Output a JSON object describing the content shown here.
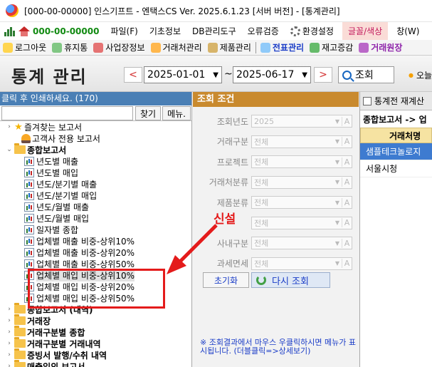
{
  "window": {
    "title": "[000-00-00000] 인스기프트 - 엔택스CS Ver. 2025.6.1.23 [서버 버전] - [통계관리]"
  },
  "menu": {
    "company_code": "000-00-00000",
    "items": [
      "파일(F)",
      "기초정보",
      "DB관리도구",
      "오류검증",
      "환경설정",
      "글꼴/색상",
      "창(W)"
    ]
  },
  "toolbar": {
    "items": [
      "로그아웃",
      "휴지통",
      "사업장정보",
      "거래처관리",
      "제품관리",
      "전표관리",
      "재고증감",
      "거래원장"
    ]
  },
  "header": {
    "title": "통계 관리",
    "date_from": "2025-01-01",
    "tilde": "~",
    "date_to": "2025-06-17",
    "search_label": "조회",
    "today_label": "오늘"
  },
  "left_panel": {
    "heading": "클릭 후 인쇄하세요. (170)",
    "search_button": "찾기",
    "menu_button": "메뉴.",
    "tree": [
      {
        "label": "즐겨찾는 보고서",
        "icon": "star",
        "level": 0,
        "toggle": ">"
      },
      {
        "label": "고객사 전용 보고서",
        "icon": "user",
        "level": 1,
        "toggle": ""
      },
      {
        "label": "종합보고서",
        "icon": "folder",
        "level": 0,
        "toggle": "v"
      },
      {
        "label": "년도별 매출",
        "icon": "report",
        "level": 2
      },
      {
        "label": "년도별 매입",
        "icon": "report",
        "level": 2
      },
      {
        "label": "년도/분기별 매출",
        "icon": "report",
        "level": 2
      },
      {
        "label": "년도/분기별 매입",
        "icon": "report",
        "level": 2
      },
      {
        "label": "년도/월별 매출",
        "icon": "report",
        "level": 2
      },
      {
        "label": "년도/월별 매입",
        "icon": "report",
        "level": 2
      },
      {
        "label": "일자별 종합",
        "icon": "report",
        "level": 2
      },
      {
        "label": "업체별 매출 비중-상위10%",
        "icon": "report",
        "level": 2
      },
      {
        "label": "업체별 매출 비중-상위20%",
        "icon": "report",
        "level": 2
      },
      {
        "label": "업체별 매출 비중-상위50%",
        "icon": "report",
        "level": 2
      },
      {
        "label": "업체별 매입 비중-상위10%",
        "icon": "report",
        "level": 2,
        "selected": true
      },
      {
        "label": "업체별 매입 비중-상위20%",
        "icon": "report",
        "level": 2
      },
      {
        "label": "업체별 매입 비중-상위50%",
        "icon": "report",
        "level": 2
      },
      {
        "label": "종합보고서 (내역)",
        "icon": "folder",
        "level": 0,
        "toggle": ">",
        "bold": true
      },
      {
        "label": "거래장",
        "icon": "folder",
        "level": 0,
        "toggle": ">",
        "bold": true
      },
      {
        "label": "거래구분별 종합",
        "icon": "folder",
        "level": 0,
        "toggle": ">",
        "bold": true
      },
      {
        "label": "거래구분별 거래내역",
        "icon": "folder",
        "level": 0,
        "toggle": ">",
        "bold": true
      },
      {
        "label": "증빙서 발행/수취 내역",
        "icon": "folder",
        "level": 0,
        "toggle": ">",
        "bold": true
      },
      {
        "label": "매출입외 보고서",
        "icon": "folder",
        "level": 0,
        "toggle": ">",
        "bold": true
      }
    ]
  },
  "annotation": {
    "label": "신설"
  },
  "conditions": {
    "heading": "조회 조건",
    "fields": [
      {
        "label": "조회년도",
        "value": "2025"
      },
      {
        "label": "거래구분",
        "value": "전체"
      },
      {
        "label": "프로젝트",
        "value": "전체"
      },
      {
        "label": "거래처분류",
        "value": "전체"
      },
      {
        "label": "제품분류",
        "value": "전체"
      },
      {
        "label": "",
        "value": "전체"
      },
      {
        "label": "사내구분",
        "value": "전체"
      },
      {
        "label": "과세면세",
        "value": "전체"
      }
    ],
    "reset_label": "초기화",
    "retry_label": "다시 조회",
    "note": "※ 조회결과에서 마우스 우클릭하시면 메뉴가 표시됩니다. (더블클릭=>상세보기)"
  },
  "right_panel": {
    "tab_label": "통계전 재계산",
    "path_label": "종합보고서 -> 업",
    "column_header": "거래처명",
    "rows": [
      "샘플테크놀로지",
      "서울시청"
    ]
  }
}
